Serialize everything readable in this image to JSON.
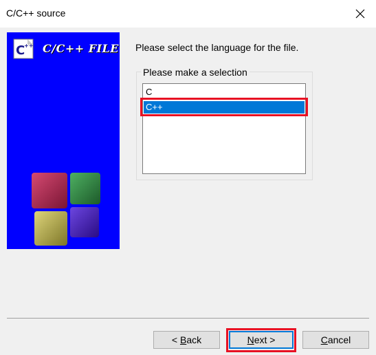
{
  "window": {
    "title": "C/C++ source",
    "close_icon": "close-icon"
  },
  "banner": {
    "title": "C/C++ FILE",
    "logo_icon": "codeblocks-file-icon",
    "background": "#0000ff",
    "cube_colors": [
      "#b0234a",
      "#2d8a3e",
      "#b9b04a",
      "#4b1fc0"
    ]
  },
  "main": {
    "prompt": "Please select the language for the file.",
    "group_label": "Please make a selection",
    "options": [
      "C",
      "C++"
    ],
    "selected": "C++"
  },
  "buttons": {
    "back_prefix": "< ",
    "back_key": "B",
    "back_rest": "ack",
    "next_key": "N",
    "next_rest": "ext >",
    "cancel_key": "C",
    "cancel_rest": "ancel"
  },
  "colors": {
    "selection": "#0078d7",
    "annotation": "#e81123"
  }
}
